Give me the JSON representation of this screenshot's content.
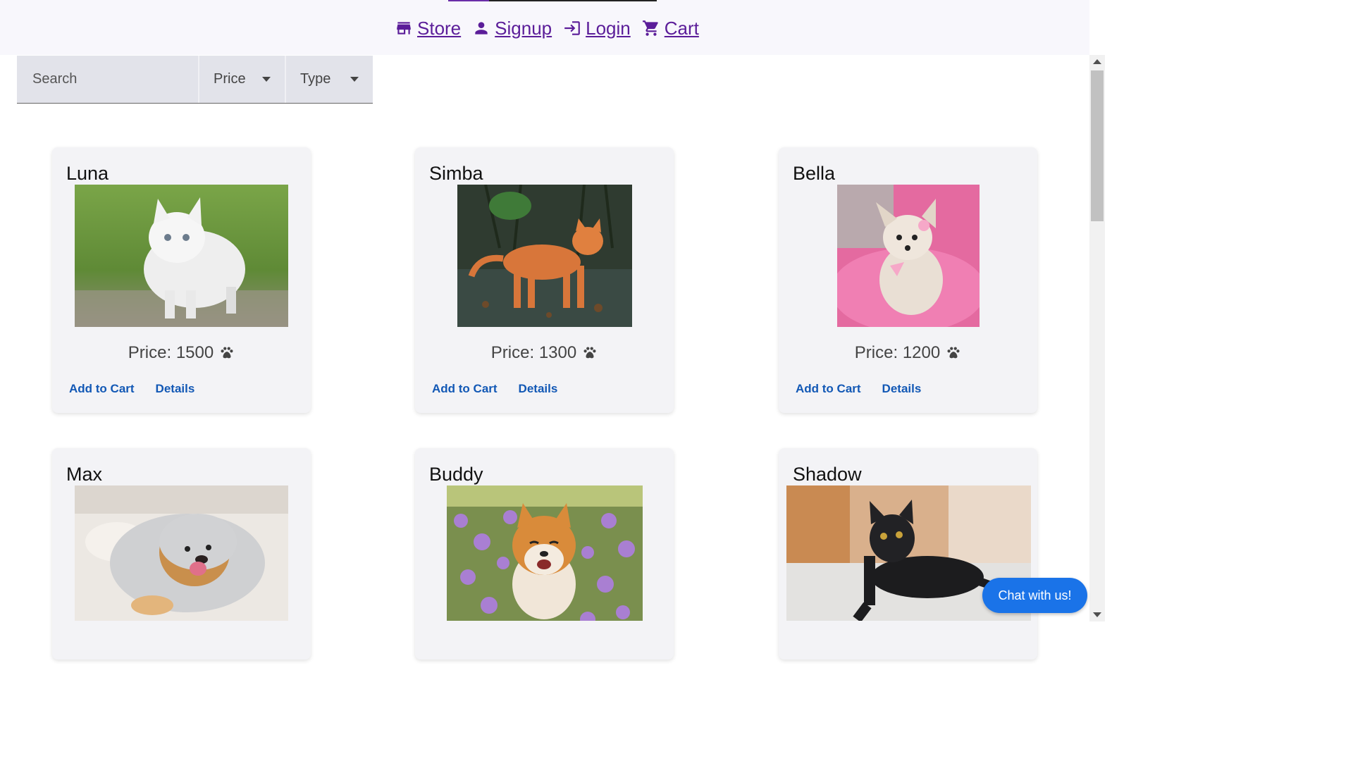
{
  "nav": {
    "links": [
      {
        "label": "Store",
        "icon": "store-icon"
      },
      {
        "label": "Signup",
        "icon": "person-icon"
      },
      {
        "label": "Login",
        "icon": "login-icon"
      },
      {
        "label": "Cart",
        "icon": "cart-icon"
      }
    ],
    "color": "#5b1d99"
  },
  "filters": {
    "search_placeholder": "Search",
    "price_label": "Price",
    "type_label": "Type"
  },
  "pets": [
    {
      "name": "Luna",
      "price_text": "Price: 1500",
      "add_label": "Add to Cart",
      "details_label": "Details",
      "image": "white cat on grass"
    },
    {
      "name": "Simba",
      "price_text": "Price: 1300",
      "add_label": "Add to Cart",
      "details_label": "Details",
      "image": "orange tabby cat"
    },
    {
      "name": "Bella",
      "price_text": "Price: 1200",
      "add_label": "Add to Cart",
      "details_label": "Details",
      "image": "small dog on pink fur"
    },
    {
      "name": "Max",
      "image": "golden retriever under blanket"
    },
    {
      "name": "Buddy",
      "image": "shiba inu in flowers"
    },
    {
      "name": "Shadow",
      "image": "black cat on bed"
    }
  ],
  "chat": {
    "label": "Chat with us!"
  },
  "colors": {
    "accent": "#1a73e8",
    "link": "#1258b5",
    "nav": "#5b1d99"
  }
}
